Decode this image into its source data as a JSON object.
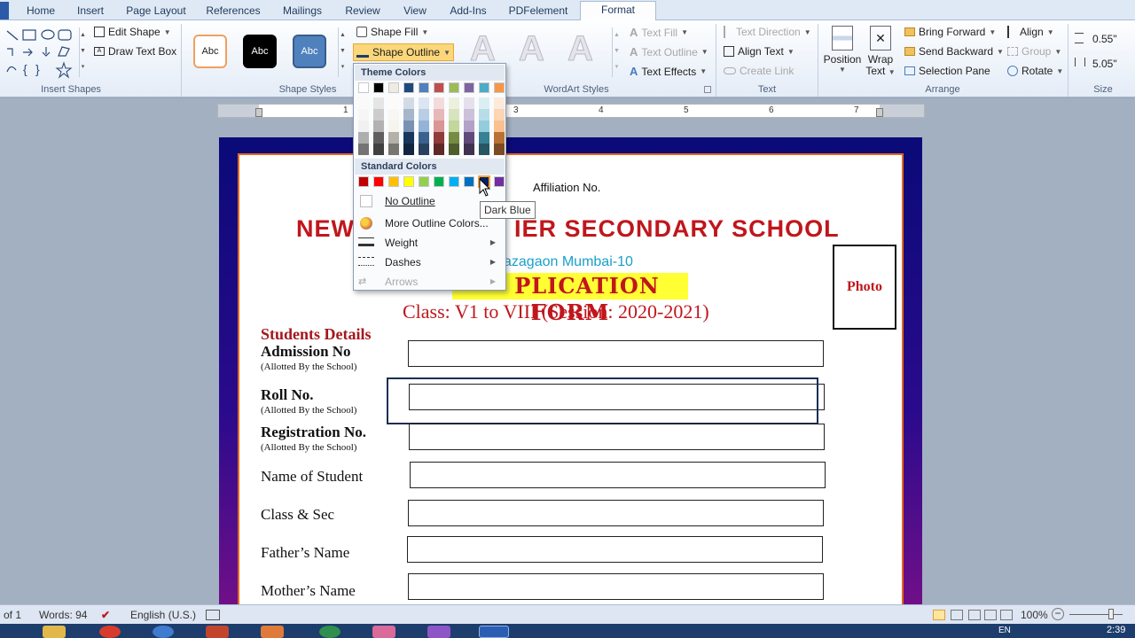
{
  "tabs": [
    "Home",
    "Insert",
    "Page Layout",
    "References",
    "Mailings",
    "Review",
    "View",
    "Add-Ins",
    "PDFelement",
    "Format"
  ],
  "ribbon": {
    "insert_shapes": {
      "label": "Insert Shapes",
      "edit_shape": "Edit Shape",
      "draw_text_box": "Draw Text Box"
    },
    "shape_styles": {
      "label": "Shape Styles",
      "style_sample": "Abc",
      "shape_fill": "Shape Fill",
      "shape_outline": "Shape Outline"
    },
    "wordart_styles": {
      "label": "WordArt Styles",
      "letter": "A",
      "text_fill": "Text Fill",
      "text_outline": "Text Outline",
      "text_effects": "Text Effects"
    },
    "text": {
      "label": "Text",
      "text_direction": "Text Direction",
      "align_text": "Align Text",
      "create_link": "Create Link"
    },
    "arrange": {
      "label": "Arrange",
      "position": "Position",
      "wrap_text_line1": "Wrap",
      "wrap_text_line2": "Text",
      "bring_forward": "Bring Forward",
      "send_backward": "Send Backward",
      "selection_pane": "Selection Pane",
      "align": "Align",
      "group": "Group",
      "rotate": "Rotate"
    },
    "size": {
      "label": "Size",
      "height": "0.55\"",
      "width": "5.05\""
    }
  },
  "ruler_numbers": [
    "1",
    "3",
    "4",
    "5",
    "6",
    "7"
  ],
  "dropdown": {
    "theme_colors_header": "Theme Colors",
    "standard_colors_header": "Standard Colors",
    "theme_top_row": [
      "#ffffff",
      "#000000",
      "#eeece1",
      "#1f497d",
      "#4f81bd",
      "#c0504d",
      "#9bbb59",
      "#8064a2",
      "#4bacc6",
      "#f79646"
    ],
    "standard_colors": [
      "#c00000",
      "#ff0000",
      "#ffc000",
      "#ffff00",
      "#92d050",
      "#00b050",
      "#00b0f0",
      "#0070c0",
      "#002060",
      "#7030a0"
    ],
    "items": {
      "no_outline": "No Outline",
      "more_outline_colors": "More Outline Colors...",
      "weight": "Weight",
      "dashes": "Dashes",
      "arrows": "Arrows"
    },
    "tooltip": "Dark Blue"
  },
  "document": {
    "affiliation": "Affiliation No.",
    "school_left": "NEW",
    "school_right": "IER SECONDARY SCHOOL",
    "address": "azagaon Mumbai-10",
    "application_form": "PLICATION FORM",
    "class_line": "Class: V1 to VIII (Session: 2020-2021)",
    "photo": "Photo",
    "students_details": "Students Details",
    "fields": [
      {
        "label": "Admission No",
        "sub": "(Allotted By the School)"
      },
      {
        "label": "Roll No.",
        "sub": "(Allotted By the School)"
      },
      {
        "label": "Registration No.",
        "sub": "(Allotted By the School)"
      },
      {
        "label": "Name of Student",
        "sub": ""
      },
      {
        "label": "Class & Sec",
        "sub": ""
      },
      {
        "label": "Father’s Name",
        "sub": ""
      },
      {
        "label": "Mother’s Name",
        "sub": ""
      }
    ]
  },
  "status_bar": {
    "page": "of 1",
    "words": "Words: 94",
    "language": "English (U.S.)",
    "zoom": "100%"
  },
  "taskbar": {
    "lang": "EN",
    "time": "2:39"
  }
}
